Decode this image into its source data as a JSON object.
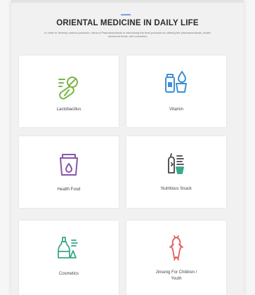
{
  "header": {
    "title": "ORIENTAL MEDICINE IN DAILY LIFE",
    "description": "In order to develop various products, Hanzoo Pharmaceuticals is introducing the best products by utilizing the pharmaceuticals, health functional foods, and cosmetics"
  },
  "categories": [
    {
      "label": "Lactobacillus",
      "icon": "lactobacillus-capsule-icon",
      "color": "#7bb446"
    },
    {
      "label": "Vitamin",
      "icon": "vitamin-bottle-icon",
      "color": "#3f8fd1"
    },
    {
      "label": "Health Food",
      "icon": "health-food-basket-icon",
      "color": "#8a55a8"
    },
    {
      "label": "Nutritious Snack",
      "icon": "nutritious-snack-icon",
      "color": "#444444"
    },
    {
      "label": "Cosmetics",
      "icon": "cosmetics-bottle-icon",
      "color": "#3aa889"
    },
    {
      "label": "Jinseng For Children / Youth",
      "icon": "ginseng-icon",
      "color": "#e05f5f"
    }
  ]
}
